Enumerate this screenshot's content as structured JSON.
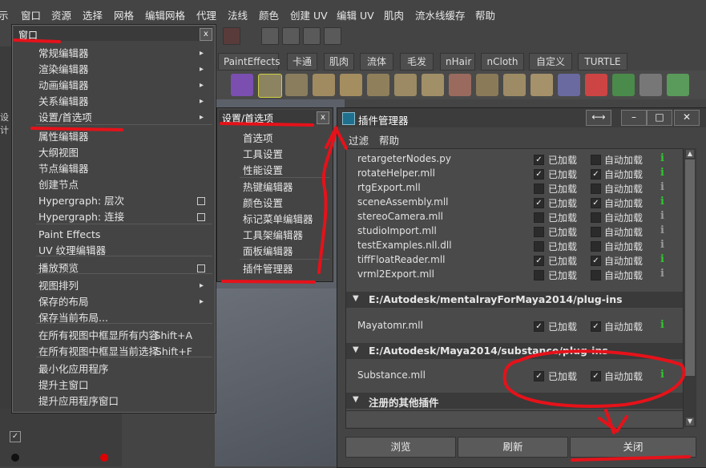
{
  "main_menu": [
    "示",
    "窗口",
    "资源",
    "选择",
    "网格",
    "编辑网格",
    "代理",
    "法线",
    "颜色",
    "创建 UV",
    "编辑 UV",
    "肌肉",
    "流水线缓存",
    "帮助"
  ],
  "shelf_tabs": [
    "PaintEffects",
    "卡通",
    "肌肉",
    "流体",
    "毛发",
    "nHair",
    "nCloth",
    "自定义",
    "TURTLE"
  ],
  "left_panel_label": "设计",
  "window_menu": {
    "title": "窗口",
    "items": [
      {
        "label": "常规编辑器",
        "arrow": "▸"
      },
      {
        "label": "渲染编辑器",
        "arrow": "▸"
      },
      {
        "label": "动画编辑器",
        "arrow": "▸"
      },
      {
        "label": "关系编辑器",
        "arrow": "▸"
      },
      {
        "label": "设置/首选项",
        "arrow": "▸"
      },
      {
        "label": "属性编辑器"
      },
      {
        "label": "大纲视图"
      },
      {
        "label": "节点编辑器"
      },
      {
        "label": "创建节点"
      },
      {
        "label": "Hypergraph: 层次"
      },
      {
        "label": "Hypergraph: 连接"
      },
      {
        "label": "Paint Effects"
      },
      {
        "label": "UV 纹理编辑器"
      },
      {
        "label": "播放预览"
      },
      {
        "label": "视图排列",
        "arrow": "▸"
      },
      {
        "label": "保存的布局",
        "arrow": "▸"
      },
      {
        "label": "保存当前布局..."
      },
      {
        "label": "在所有视图中框显所有内容",
        "shortcut": "Shift+A"
      },
      {
        "label": "在所有视图中框显当前选择",
        "shortcut": "Shift+F"
      },
      {
        "label": "最小化应用程序"
      },
      {
        "label": "提升主窗口"
      },
      {
        "label": "提升应用程序窗口"
      }
    ]
  },
  "settings_menu": {
    "title": "设置/首选项",
    "items": [
      "首选项",
      "工具设置",
      "性能设置",
      "热键编辑器",
      "颜色设置",
      "标记菜单编辑器",
      "工具架编辑器",
      "面板编辑器",
      "插件管理器"
    ]
  },
  "plugin_manager": {
    "title": "插件管理器",
    "menu": [
      "过滤",
      "帮助"
    ],
    "loaded_label": "已加载",
    "autoload_label": "自动加载",
    "rows": [
      {
        "name": "retargeterNodes.py",
        "loaded": true,
        "auto": false,
        "active": true
      },
      {
        "name": "rotateHelper.mll",
        "loaded": true,
        "auto": true,
        "active": true
      },
      {
        "name": "rtgExport.mll",
        "loaded": false,
        "auto": false,
        "active": false
      },
      {
        "name": "sceneAssembly.mll",
        "loaded": true,
        "auto": true,
        "active": true
      },
      {
        "name": "stereoCamera.mll",
        "loaded": false,
        "auto": false,
        "active": false
      },
      {
        "name": "studioImport.mll",
        "loaded": false,
        "auto": false,
        "active": false
      },
      {
        "name": "testExamples.nll.dll",
        "loaded": false,
        "auto": false,
        "active": false
      },
      {
        "name": "tiffFloatReader.mll",
        "loaded": true,
        "auto": true,
        "active": true
      },
      {
        "name": "vrml2Export.mll",
        "loaded": false,
        "auto": false,
        "active": false
      }
    ],
    "groups": [
      {
        "path": "E:/Autodesk/mentalrayForMaya2014/plug-ins",
        "rows": [
          {
            "name": "Mayatomr.mll",
            "loaded": true,
            "auto": true,
            "active": true
          }
        ]
      },
      {
        "path": "E:/Autodesk/Maya2014/substance/plug-ins",
        "rows": [
          {
            "name": "Substance.mll",
            "loaded": true,
            "auto": true,
            "active": true
          }
        ]
      },
      {
        "path": "注册的其他插件",
        "rows": []
      }
    ],
    "buttons": {
      "browse": "浏览",
      "refresh": "刷新",
      "close": "关闭"
    },
    "info_glyph": "i",
    "check_glyph": "✓"
  },
  "colors": {
    "annotation": "#e5121a",
    "loaded_green": "#2ec82e"
  }
}
